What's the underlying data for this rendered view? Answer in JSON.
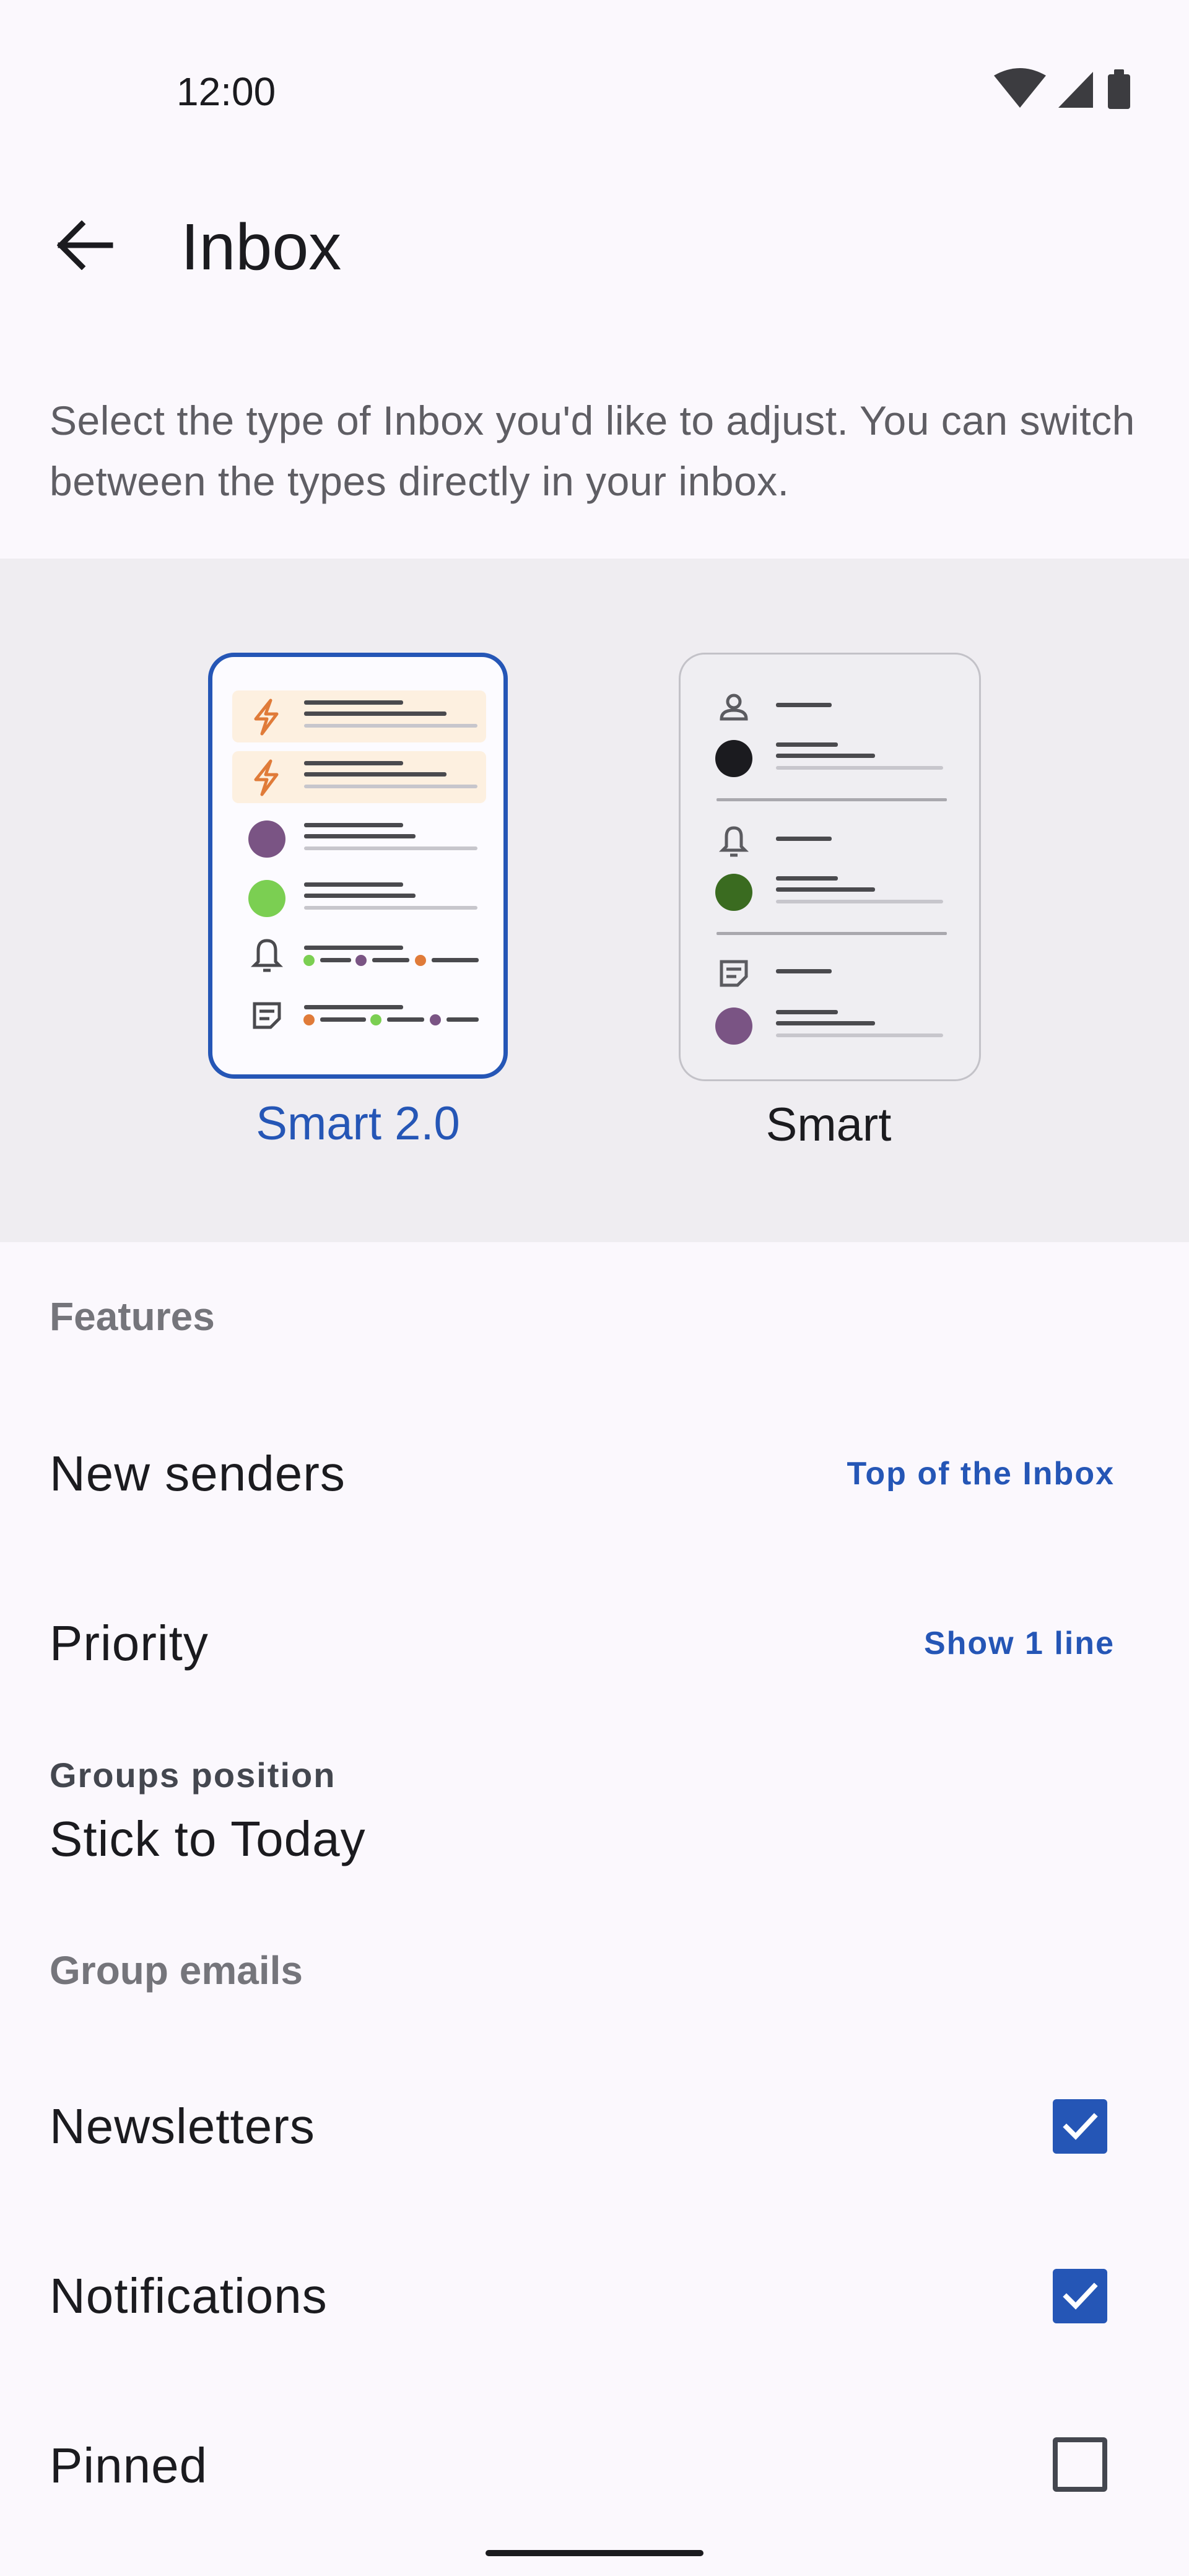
{
  "status_bar": {
    "time": "12:00",
    "icons": [
      "wifi-icon",
      "cell-signal-icon",
      "battery-icon"
    ]
  },
  "app_bar": {
    "back_icon": "arrow-back-icon",
    "title": "Inbox"
  },
  "description": "Select the type of Inbox you'd like to adjust. You can switch between the types directly in your inbox.",
  "inbox_types": [
    {
      "label": "Smart 2.0",
      "selected": true
    },
    {
      "label": "Smart",
      "selected": false
    }
  ],
  "features": {
    "header": "Features",
    "new_senders": {
      "label": "New senders",
      "value": "Top of the Inbox"
    },
    "priority": {
      "label": "Priority",
      "value": "Show 1 line"
    },
    "groups_position": {
      "overline": "Groups position",
      "label": "Stick to Today"
    }
  },
  "group_emails": {
    "header": "Group emails",
    "items": [
      {
        "label": "Newsletters",
        "checked": true
      },
      {
        "label": "Notifications",
        "checked": true
      },
      {
        "label": "Pinned",
        "checked": false
      }
    ]
  },
  "colors": {
    "accent": "#2556b6",
    "panel_bg": "#efedf1",
    "page_bg": "#fbf8fd",
    "orange": "#e07b39",
    "purple": "#7a5484",
    "green": "#7bcf52",
    "dark_green": "#3a6b20"
  }
}
